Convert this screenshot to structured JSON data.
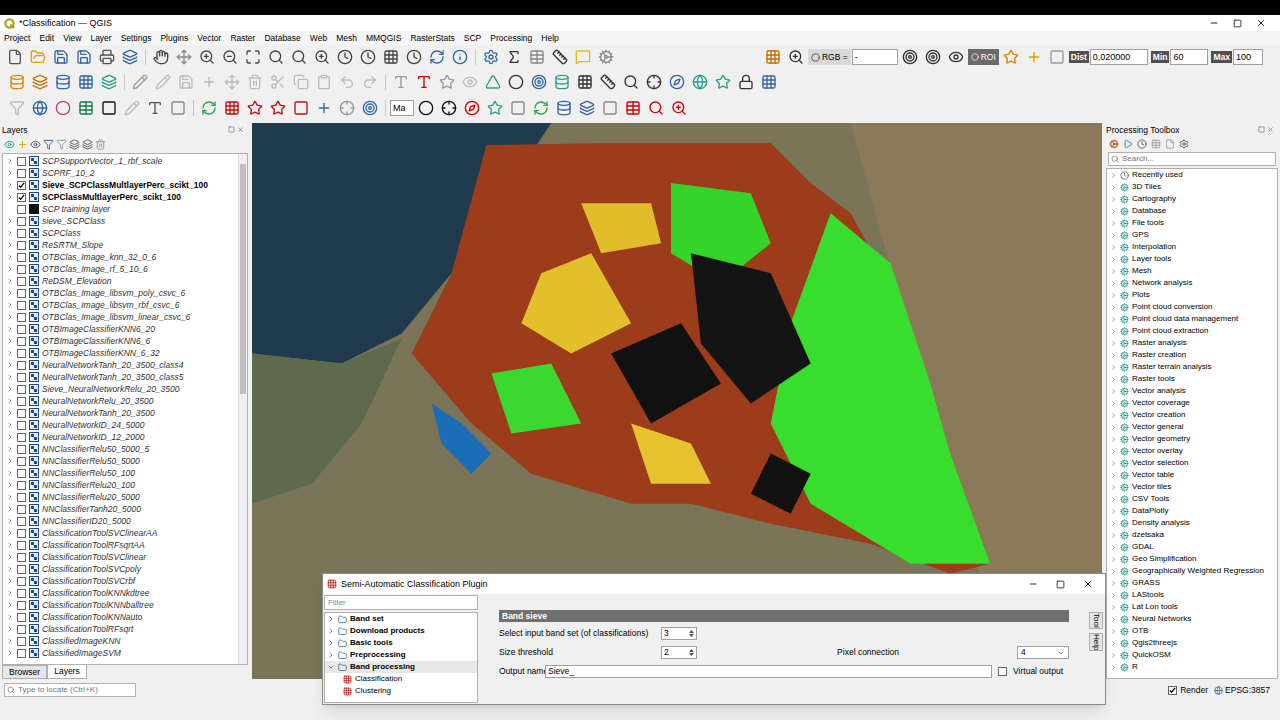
{
  "window": {
    "title": "*Classification — QGIS"
  },
  "menu": [
    "Project",
    "Edit",
    "View",
    "Layer",
    "Settings",
    "Plugins",
    "Vector",
    "Raster",
    "Database",
    "Web",
    "Mesh",
    "MMQGIS",
    "RasterStats",
    "SCP",
    "Processing",
    "Help"
  ],
  "toolbar": {
    "rgb_label": "RGB =",
    "rgb_value": "-",
    "roi": "ROI",
    "dist_label": "Dist",
    "dist_value": "0,020000",
    "min_label": "Min",
    "min_value": "60",
    "max_label": "Max",
    "max_value": "100",
    "map_field": "Ma"
  },
  "layers_panel": {
    "title": "Layers",
    "layers": [
      {
        "name": "SCPSupportVector_1_rbf_scale",
        "checked": false,
        "kind": "raster"
      },
      {
        "name": "SCPRF_10_2",
        "checked": false,
        "kind": "raster"
      },
      {
        "name": "Sieve_SCPClassMultlayerPerc_scikt_100",
        "checked": true,
        "kind": "raster"
      },
      {
        "name": "SCPClassMultlayerPerc_scikt_100",
        "checked": true,
        "kind": "raster"
      },
      {
        "name": "SCP training layer",
        "checked": false,
        "kind": "vector"
      },
      {
        "name": "sieve_SCPClass",
        "checked": false,
        "kind": "raster"
      },
      {
        "name": "SCPClass",
        "checked": false,
        "kind": "raster"
      },
      {
        "name": "ReSRTM_Slope",
        "checked": false,
        "kind": "raster"
      },
      {
        "name": "OTBClas_Image_knn_32_0_6",
        "checked": false,
        "kind": "raster"
      },
      {
        "name": "OTBClas_Image_rf_5_10_6",
        "checked": false,
        "kind": "raster"
      },
      {
        "name": "ReDSM_Elevation",
        "checked": false,
        "kind": "raster"
      },
      {
        "name": "OTBClas_Image_libsvm_poly_csvc_6",
        "checked": false,
        "kind": "raster"
      },
      {
        "name": "OTBClas_Image_libsvm_rbf_csvc_6",
        "checked": false,
        "kind": "raster"
      },
      {
        "name": "OTBClas_Image_libsvm_linear_csvc_6",
        "checked": false,
        "kind": "raster"
      },
      {
        "name": "OTBImageClassifierKNN6_20",
        "checked": false,
        "kind": "raster"
      },
      {
        "name": "OTBImageClassifierKNN6_6",
        "checked": false,
        "kind": "raster"
      },
      {
        "name": "OTBImageClassifierKNN_6_32",
        "checked": false,
        "kind": "raster"
      },
      {
        "name": "NeuralNetworkTanh_20_3500_class4",
        "checked": false,
        "kind": "raster"
      },
      {
        "name": "NeuralNetworkTanh_20_3500_class5",
        "checked": false,
        "kind": "raster"
      },
      {
        "name": "Sieve_NeuralNetworkRelu_20_3500",
        "checked": false,
        "kind": "raster"
      },
      {
        "name": "NeuralNetworkRelu_20_3500",
        "checked": false,
        "kind": "raster"
      },
      {
        "name": "NeuralNetworkTanh_20_3500",
        "checked": false,
        "kind": "raster"
      },
      {
        "name": "NeuralNetworkID_24_5000",
        "checked": false,
        "kind": "raster"
      },
      {
        "name": "NeuralNetworkID_12_2000",
        "checked": false,
        "kind": "raster"
      },
      {
        "name": "NNClassifierRelu50_5000_5",
        "checked": false,
        "kind": "raster"
      },
      {
        "name": "NNClassifierRelu50_5000",
        "checked": false,
        "kind": "raster"
      },
      {
        "name": "NNClassifierRelu50_100",
        "checked": false,
        "kind": "raster"
      },
      {
        "name": "NNClassifierRelu20_100",
        "checked": false,
        "kind": "raster"
      },
      {
        "name": "NNClassifierRelu20_5000",
        "checked": false,
        "kind": "raster"
      },
      {
        "name": "NNClassifierTanh20_5000",
        "checked": false,
        "kind": "raster"
      },
      {
        "name": "NNClassifierID20_5000",
        "checked": false,
        "kind": "raster"
      },
      {
        "name": "ClassificationToolSVClinearAA",
        "checked": false,
        "kind": "raster"
      },
      {
        "name": "ClassificationToolRFsqrtAA",
        "checked": false,
        "kind": "raster"
      },
      {
        "name": "ClassificationToolSVClinear",
        "checked": false,
        "kind": "raster"
      },
      {
        "name": "ClassificationToolSVCpoly",
        "checked": false,
        "kind": "raster"
      },
      {
        "name": "ClassificationToolSVCrbf",
        "checked": false,
        "kind": "raster"
      },
      {
        "name": "ClassificationToolKNNkdtree",
        "checked": false,
        "kind": "raster"
      },
      {
        "name": "ClassificationToolKNNballtree",
        "checked": false,
        "kind": "raster"
      },
      {
        "name": "ClassificationToolKNNauto",
        "checked": false,
        "kind": "raster"
      },
      {
        "name": "ClassificationToolRFsqrt",
        "checked": false,
        "kind": "raster"
      },
      {
        "name": "ClassifiedImageKNN",
        "checked": false,
        "kind": "raster"
      },
      {
        "name": "ClassifiedImageSVM",
        "checked": false,
        "kind": "raster"
      }
    ],
    "tabs": [
      {
        "label": "Browser",
        "selected": false
      },
      {
        "label": "Layers",
        "selected": true
      }
    ]
  },
  "locator": {
    "placeholder": "Type to locate (Ctrl+K)"
  },
  "toolbox": {
    "title": "Processing Toolbox",
    "search_placeholder": "Search...",
    "items": [
      "Recently used",
      "3D Tiles",
      "Cartography",
      "Database",
      "File tools",
      "GPS",
      "Interpolation",
      "Layer tools",
      "Mesh",
      "Network analysis",
      "Plots",
      "Point cloud conversion",
      "Point cloud data management",
      "Point cloud extraction",
      "Raster analysis",
      "Raster creation",
      "Raster terrain analysis",
      "Raster tools",
      "Vector analysis",
      "Vector coverage",
      "Vector creation",
      "Vector general",
      "Vector geometry",
      "Vector overlay",
      "Vector selection",
      "Vector table",
      "Vector tiles",
      "CSV Tools",
      "DataPlotly",
      "Density analysis",
      "dzetsaka",
      "GDAL",
      "Geo Simplification",
      "Geographically Weighted Regression",
      "GRASS",
      "LAStools",
      "Lat Lon tools",
      "Neural Networks",
      "OTB",
      "Qgis2threejs",
      "QuickOSM",
      "R"
    ]
  },
  "status_bar": {
    "render_label": "Render",
    "render_checked": true,
    "crs": "EPSG:3857"
  },
  "scp_dialog": {
    "title": "Semi-Automatic Classification Plugin",
    "filter_placeholder": "Filter",
    "tree": [
      {
        "label": "Band set",
        "kind": "group",
        "expanded": false,
        "selected": false
      },
      {
        "label": "Download products",
        "kind": "group",
        "expanded": false,
        "selected": false
      },
      {
        "label": "Basic tools",
        "kind": "group",
        "expanded": false,
        "selected": false
      },
      {
        "label": "Preprocessing",
        "kind": "group",
        "expanded": false,
        "selected": false
      },
      {
        "label": "Band processing",
        "kind": "group",
        "expanded": true,
        "selected": false
      },
      {
        "label": "Classification",
        "kind": "item",
        "expanded": false,
        "selected": false
      },
      {
        "label": "Clustering",
        "kind": "item",
        "expanded": false,
        "selected": false
      }
    ],
    "section_title": "Band sieve",
    "band_set_label": "Select input band set (of classifications)",
    "band_set_value": "3",
    "size_label": "Size threshold",
    "size_value": "2",
    "connection_label": "Pixel connection",
    "connection_value": "4",
    "output_label": "Output name",
    "output_value": "Sieve_",
    "virtual_label": "Virtual output",
    "virtual_checked": false,
    "side_tabs": [
      "Tool",
      "Help"
    ]
  }
}
